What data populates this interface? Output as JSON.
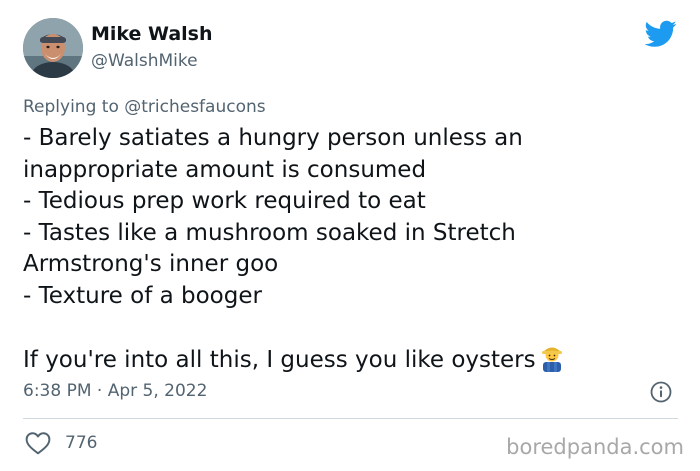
{
  "author": {
    "display_name": "Mike Walsh",
    "handle": "@WalshMike"
  },
  "reply": {
    "label": "Replying to @trichesfaucons"
  },
  "tweet": {
    "lines": [
      "- Barely satiates a hungry person unless an",
      "inappropriate amount is consumed",
      "- Tedious prep work required to eat",
      "- Tastes like a mushroom soaked in Stretch",
      "Armstrong's inner goo",
      "- Texture of a booger"
    ],
    "closing": "If you're into all this, I guess you like oysters"
  },
  "meta": {
    "timestamp": "6:38 PM · Apr 5, 2022"
  },
  "engagement": {
    "likes": "776"
  },
  "watermark": "boredpanda.com",
  "colors": {
    "twitter_blue": "#1d9bf0",
    "secondary_text": "#536471",
    "divider": "#cfd9de"
  },
  "icons": {
    "brand": "twitter-bird-icon",
    "info": "info-icon",
    "like": "heart-icon",
    "emoji": "man-farmer-emoji"
  }
}
